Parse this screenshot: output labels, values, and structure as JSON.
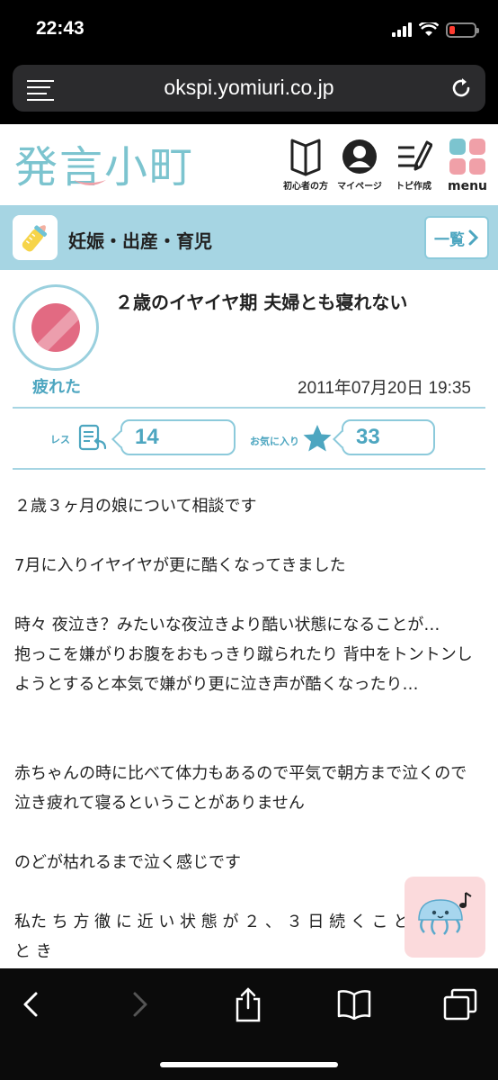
{
  "status_bar": {
    "time": "22:43"
  },
  "browser": {
    "url": "okspi.yomiuri.co.jp"
  },
  "site": {
    "logo": "発言小町",
    "nav": [
      {
        "label": "初心者の方",
        "icon": "book-icon"
      },
      {
        "label": "マイページ",
        "icon": "user-icon"
      },
      {
        "label": "トピ作成",
        "icon": "compose-icon"
      },
      {
        "label": "menu",
        "icon": "menu-grid-icon"
      }
    ]
  },
  "category": {
    "title": "妊娠・出産・育児",
    "icon": "baby-bottle-icon",
    "list_button": "一覧"
  },
  "topic": {
    "title": "２歳のイヤイヤ期 夫婦とも寝れない",
    "mood_label": "疲れた",
    "date": "2011年07月20日 19:35",
    "replies_label": "レス",
    "replies_count": "14",
    "favorites_label": "お気に入り",
    "favorites_count": "33",
    "body": [
      "２歳３ヶ月の娘について相談です",
      "",
      "7月に入りイヤイヤが更に酷くなってきました",
      "",
      "時々 夜泣き？みたいな夜泣きより酷い状態になることが…",
      "抱っこを嫌がりお腹をおもっきり蹴られたり 背中をトントンしようとすると本気で嫌がり更に泣き声が酷くなったり…",
      "",
      "",
      "赤ちゃんの時に比べて体力もあるので平気で朝方まで泣くので 泣き疲れて寝るということがありません",
      "",
      "のどが枯れるまで泣く感じです",
      "",
      "私た ち 方 徹 に 近 い 状 態 が ２ 、 ３ 日 続 く こ と が あ る と き"
    ]
  },
  "colors": {
    "accent": "#4da6c0",
    "category_bg": "#a6d5e3",
    "mood": "#e26a82",
    "menu_blue": "#7cc4cf",
    "menu_pink": "#f0a0a8"
  }
}
